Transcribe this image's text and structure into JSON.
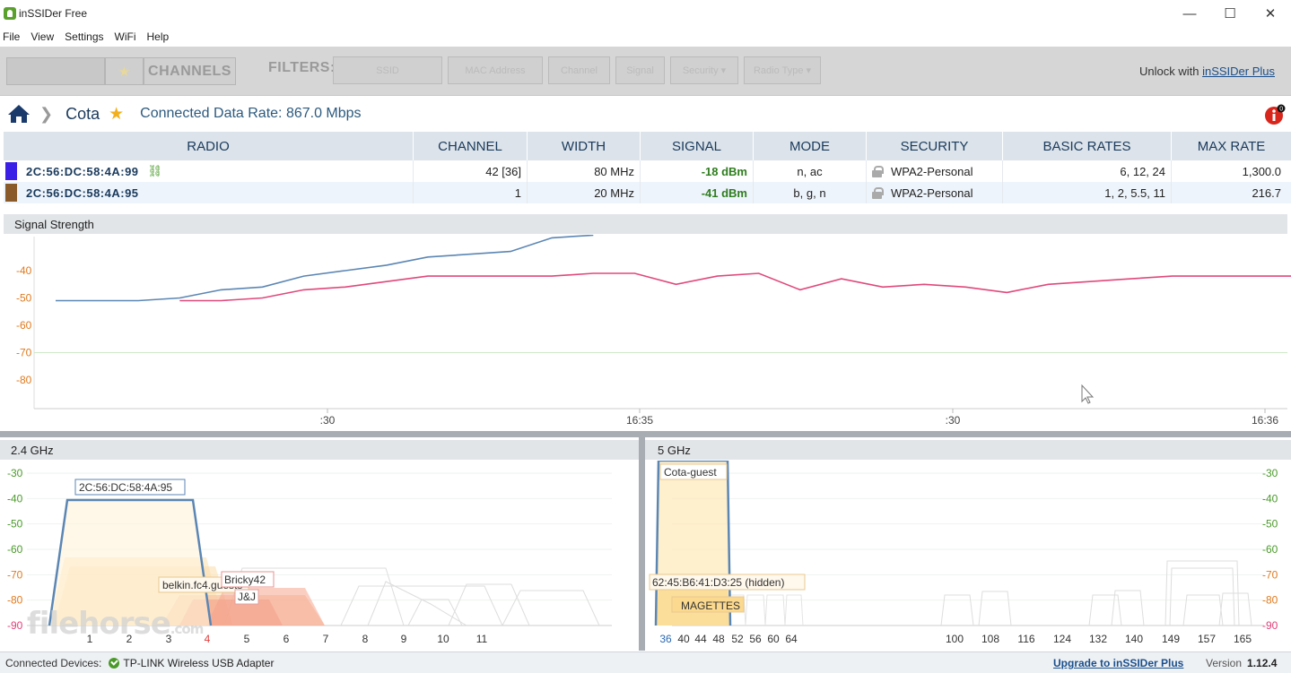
{
  "app": {
    "title": "inSSIDer Free"
  },
  "window": {
    "minimize": "—",
    "maximize": "☐",
    "close": "✕"
  },
  "menu": [
    "File",
    "View",
    "Settings",
    "WiFi",
    "Help"
  ],
  "toolbar": {
    "left_btn_label": "",
    "channels_label": "CHANNELS",
    "filters_label": "FILTERS:",
    "filters": [
      "SSID",
      "MAC Address",
      "Channel",
      "Signal",
      "Security ▾",
      "Radio Type ▾"
    ],
    "unlock_text": "Unlock with",
    "unlock_link": "inSSIDer Plus"
  },
  "breadcrumb": {
    "network": "Cota",
    "data_rate": "Connected Data Rate: 867.0 Mbps"
  },
  "table": {
    "headers": [
      "RADIO",
      "CHANNEL",
      "WIDTH",
      "SIGNAL",
      "MODE",
      "SECURITY",
      "BASIC RATES",
      "MAX RATE"
    ],
    "rows": [
      {
        "color": "#3b1fe6",
        "radio": "2C:56:DC:58:4A:99",
        "channel": "42 [36]",
        "width": "80 MHz",
        "signal": "-18 dBm",
        "mode": "n, ac",
        "security": "WPA2-Personal",
        "basic_rates": "6, 12, 24",
        "max_rate": "1,300.0"
      },
      {
        "color": "#8a5a2b",
        "radio": "2C:56:DC:58:4A:95",
        "channel": "1",
        "width": "20 MHz",
        "signal": "-41 dBm",
        "mode": "b, g, n",
        "security": "WPA2-Personal",
        "basic_rates": "1, 2, 5.5, 11",
        "max_rate": "216.7"
      }
    ]
  },
  "signal_panel": {
    "title": "Signal Strength",
    "y_ticks": [
      "-40",
      "-50",
      "-60",
      "-70",
      "-80"
    ],
    "x_ticks": [
      ":30",
      "16:35",
      ":30",
      "16:36"
    ]
  },
  "band24": {
    "title": "2.4 GHz",
    "y_ticks": [
      "-30",
      "-40",
      "-50",
      "-60",
      "-70",
      "-80",
      "-90"
    ],
    "x_ticks": [
      "1",
      "2",
      "3",
      "4",
      "5",
      "6",
      "7",
      "8",
      "9",
      "10",
      "11"
    ],
    "labels": [
      "2C:56:DC:58:4A:95",
      "belkin.fc4.guests",
      "Bricky42",
      "J&J"
    ]
  },
  "band5": {
    "title": "5 GHz",
    "y_ticks": [
      "-30",
      "-40",
      "-50",
      "-60",
      "-70",
      "-80",
      "-90"
    ],
    "x_ticks": [
      "36",
      "40",
      "44",
      "48",
      "52",
      "56",
      "60",
      "64",
      "100",
      "108",
      "116",
      "124",
      "132",
      "140",
      "149",
      "157",
      "165"
    ],
    "labels": [
      "Cota-guest",
      "62:45:B6:41:D3:25 (hidden)",
      "MAGETTES"
    ]
  },
  "status": {
    "connected_label": "Connected Devices:",
    "adapter": "TP-LINK Wireless USB Adapter",
    "upgrade": "Upgrade to inSSIDer Plus",
    "version_label": "Version",
    "version": "1.12.4"
  },
  "watermark": {
    "main": "filehorse",
    "suffix": ".com"
  },
  "chart_data": [
    {
      "type": "line",
      "title": "Signal Strength",
      "xlabel": "",
      "ylabel": "",
      "ylim": [
        -90,
        -30
      ],
      "series": [
        {
          "name": "2C:56:DC:58:4A:99",
          "color": "#5b86b4",
          "x": [
            0,
            1,
            2,
            3,
            4,
            5,
            6,
            7,
            8,
            9,
            10,
            11,
            12,
            13
          ],
          "y": [
            -51,
            -51,
            -51,
            -50,
            -47,
            -46,
            -42,
            -40,
            -38,
            -35,
            -34,
            -33,
            -28,
            -27
          ]
        },
        {
          "name": "2C:56:DC:58:4A:95",
          "color": "#e0487c",
          "x": [
            3,
            4,
            5,
            6,
            7,
            8,
            9,
            10,
            11,
            12,
            13,
            14,
            15,
            16,
            17,
            18,
            19,
            20,
            21,
            22,
            23,
            24,
            25,
            26,
            27,
            28,
            29,
            30,
            31
          ],
          "y": [
            -51,
            -51,
            -50,
            -47,
            -46,
            -44,
            -42,
            -42,
            -42,
            -42,
            -41,
            -41,
            -45,
            -42,
            -41,
            -47,
            -43,
            -46,
            -45,
            -46,
            -48,
            -45,
            -44,
            -43,
            -42,
            -42,
            -42,
            -42,
            -42
          ]
        }
      ]
    }
  ]
}
